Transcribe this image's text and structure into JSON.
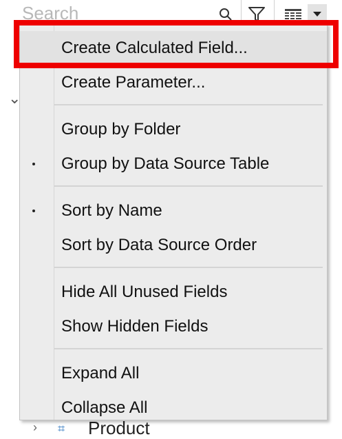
{
  "search": {
    "placeholder": "Search"
  },
  "icons": {
    "search": "search-icon",
    "filter": "filter-icon",
    "view_toggle": "grid-list-icon",
    "menu_caret": "chevron-down-icon"
  },
  "background": {
    "partial_row_label": "Product"
  },
  "menu": {
    "items": [
      {
        "label": "Create Calculated Field...",
        "checked": false,
        "highlighted": true
      },
      {
        "label": "Create Parameter...",
        "checked": false
      },
      {
        "label": "Group by Folder",
        "checked": false
      },
      {
        "label": "Group by Data Source Table",
        "checked": true
      },
      {
        "label": "Sort by Name",
        "checked": true
      },
      {
        "label": "Sort by Data Source Order",
        "checked": false
      },
      {
        "label": "Hide All Unused Fields",
        "checked": false
      },
      {
        "label": "Show Hidden Fields",
        "checked": false
      },
      {
        "label": "Expand All",
        "checked": false
      },
      {
        "label": "Collapse All",
        "checked": false
      }
    ]
  },
  "colors": {
    "highlight_border": "#ee0000",
    "menu_background": "#ececec"
  }
}
